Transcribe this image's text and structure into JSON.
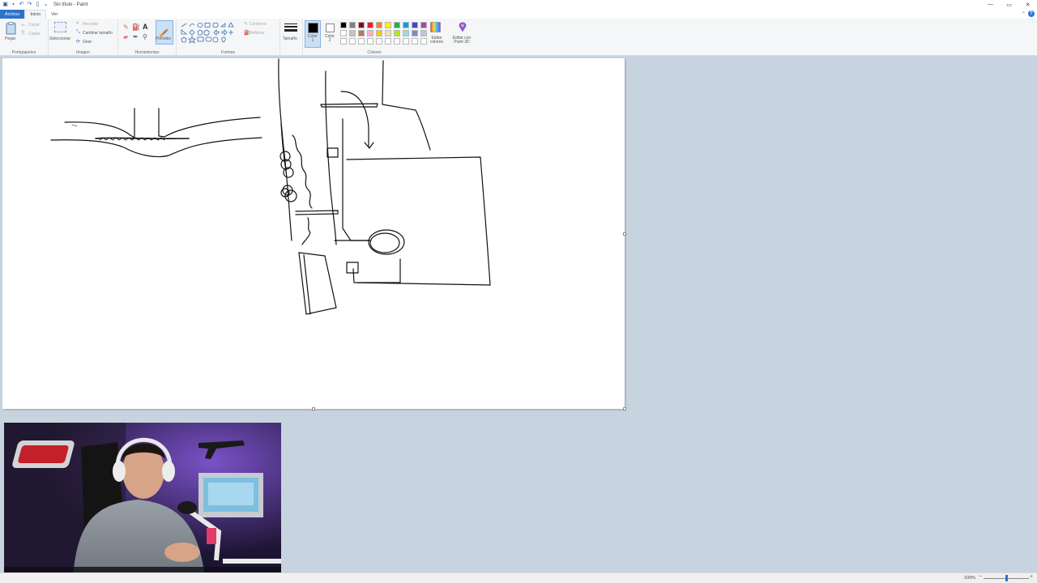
{
  "window": {
    "title": "Sin título - Paint",
    "controls": {
      "minimize": "—",
      "maximize": "▭",
      "close": "✕"
    }
  },
  "tabs": [
    {
      "label": "Archivo"
    },
    {
      "label": "Inicio"
    },
    {
      "label": "Ver"
    }
  ],
  "clipboard": {
    "paste": "Pegar",
    "cut": "Cortar",
    "copy": "Copiar",
    "group": "Portapapeles"
  },
  "image": {
    "select": "Seleccionar",
    "crop": "Recortar",
    "resize": "Cambiar tamaño",
    "rotate": "Girar",
    "group": "Imagen"
  },
  "tools": {
    "brushes": "Pinceles",
    "group": "Herramientas"
  },
  "shapes": {
    "outline": "Contorno",
    "fill": "Rellenar",
    "group": "Formas"
  },
  "size": {
    "label": "Tamaño"
  },
  "colors": {
    "color1_label": "Color 1",
    "color2_label": "Color 2",
    "edit_colors": "Editar colores",
    "edit_paint3d": "Editar con Paint 3D",
    "group": "Colores",
    "color1": "#000000",
    "color2": "#ffffff",
    "palette_row1": [
      "#000000",
      "#7f7f7f",
      "#880015",
      "#ed1c24",
      "#ff7f27",
      "#fff200",
      "#22b14c",
      "#00a2e8",
      "#3f48cc",
      "#a349a4"
    ],
    "palette_row2": [
      "#ffffff",
      "#c3c3c3",
      "#b97a57",
      "#ffaec9",
      "#ffc90e",
      "#efe4b0",
      "#b5e61d",
      "#99d9ea",
      "#7092be",
      "#c8bfe7"
    ],
    "palette_row3": [
      "#ffffff",
      "#ffffff",
      "#ffffff",
      "#ffffff",
      "#ffffff",
      "#ffffff",
      "#ffffff",
      "#ffffff",
      "#ffffff",
      "#ffffff"
    ]
  },
  "status": {
    "zoom": "100%"
  }
}
